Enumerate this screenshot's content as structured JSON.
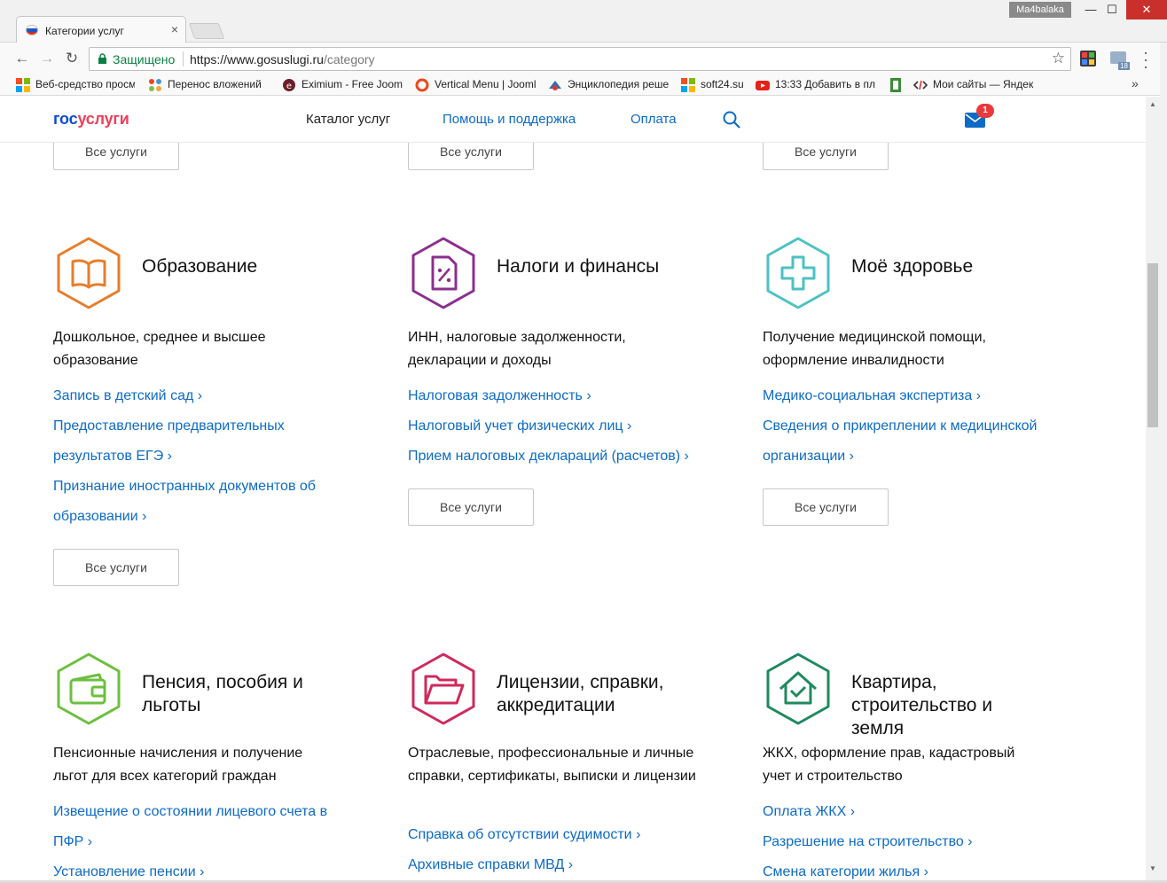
{
  "browser": {
    "tab_title": "Категории услуг",
    "user_name": "Ma4balaka",
    "secure_label": "Защищено",
    "url_host": "https://www.gosuslugi.ru",
    "url_path": "/category",
    "bookmarks": [
      {
        "label": "Веб-средство просм",
        "icon": "windows-tiles-icon"
      },
      {
        "label": "Перенос вложений",
        "icon": "joomla-icon"
      },
      {
        "label": "Eximium - Free Jooml",
        "icon": "eximium-icon"
      },
      {
        "label": "Vertical Menu | Jooml",
        "icon": "vertical-menu-icon"
      },
      {
        "label": "Энциклопедия реше",
        "icon": "encyclopedia-icon"
      },
      {
        "label": "soft24.su",
        "icon": "windows-tiles-icon"
      },
      {
        "label": "13:33 Добавить в пл",
        "icon": "youtube-icon"
      },
      {
        "label": "",
        "icon": "green-doc-icon"
      },
      {
        "label": "Мои сайты — Яндек",
        "icon": "code-icon"
      }
    ],
    "ext_badge": "18"
  },
  "header": {
    "logo_part1": "гос",
    "logo_part2": "услуги",
    "nav": [
      "Каталог услуг",
      "Помощь и поддержка",
      "Оплата"
    ],
    "mail_count": "1"
  },
  "all_services_label": "Все услуги",
  "categories": [
    {
      "title": "Образование",
      "color": "#e77d2b",
      "icon": "book-icon",
      "desc": "Дошкольное, среднее и высшее образование",
      "links": [
        "Запись в детский сад ›",
        "Предоставление предварительных результатов ЕГЭ ›",
        "Признание иностранных документов об образовании ›"
      ]
    },
    {
      "title": "Налоги и финансы",
      "color": "#8b2f8f",
      "icon": "tax-document-icon",
      "desc": "ИНН, налоговые задолженности, декларации и доходы",
      "links": [
        "Налоговая задолженность ›",
        "Налоговый учет физических лиц ›",
        "Прием налоговых деклараций (расчетов) ›"
      ]
    },
    {
      "title": "Моё здоровье",
      "color": "#4ec1c3",
      "icon": "medical-cross-icon",
      "desc": "Получение медицинской помощи, оформление инвалидности",
      "links": [
        "Медико-социальная экспертиза ›",
        "Сведения о прикреплении к медицинской организации ›"
      ]
    },
    {
      "title": "Пенсия, пособия и льготы",
      "color": "#6cbf3f",
      "icon": "wallet-icon",
      "desc": "Пенсионные начисления и получение льгот для всех категорий граждан",
      "links": [
        "Извещение о состоянии лицевого счета в ПФР ›",
        "Установление пенсии ›"
      ]
    },
    {
      "title": "Лицензии, справки, аккредитации",
      "color": "#cf2a5c",
      "icon": "folder-icon",
      "desc": "Отраслевые, профессиональные и личные справки, сертификаты, выписки и лицензии",
      "links": [
        "Справка об отсутствии судимости ›",
        "Архивные справки МВД ›"
      ]
    },
    {
      "title": "Квартира, строительство и земля",
      "color": "#1f8a5e",
      "icon": "house-check-icon",
      "desc": "ЖКХ, оформление прав, кадастровый учет и строительство",
      "links": [
        "Оплата ЖКХ ›",
        "Разрешение на строительство ›",
        "Смена категории жилья ›"
      ]
    }
  ]
}
